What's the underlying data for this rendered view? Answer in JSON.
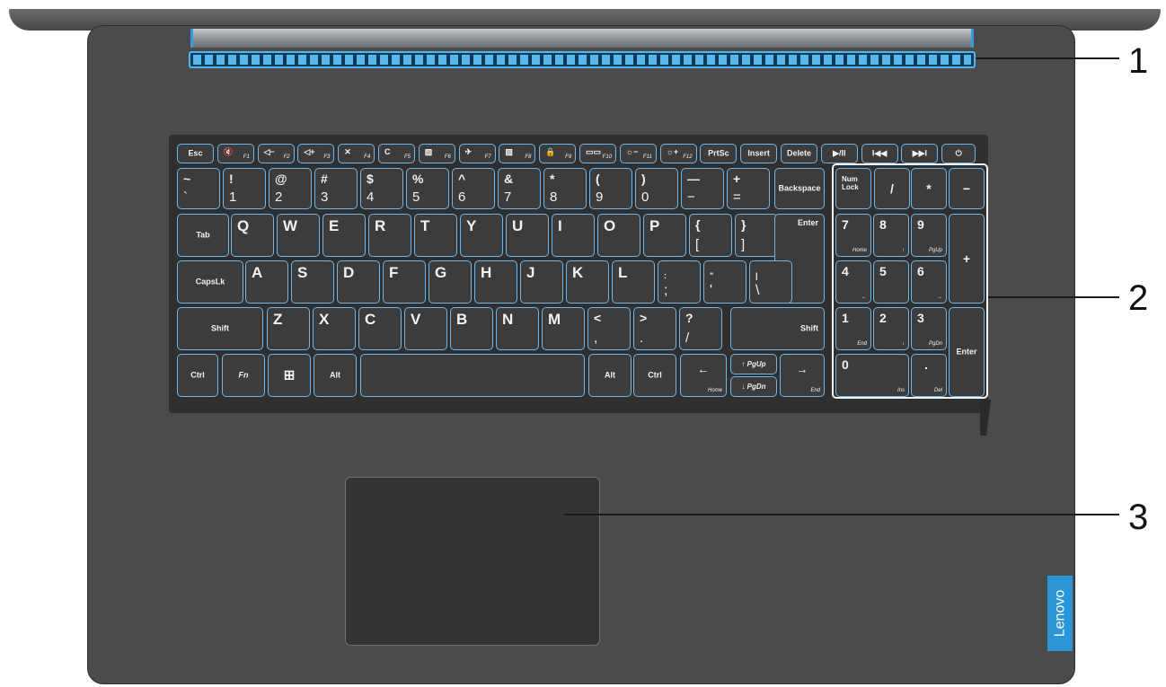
{
  "brand": {
    "logo_text": "Lenovo",
    "logo_color": "#2a96d6"
  },
  "callouts": [
    "1",
    "2",
    "3"
  ],
  "colors": {
    "key_backlight": "#6fb6ea",
    "deck": "#4b4b4b"
  },
  "keyboard": {
    "function_row": [
      {
        "main": "Esc",
        "sub": ""
      },
      {
        "main": "🔇",
        "sub": "F1"
      },
      {
        "main": "◁−",
        "sub": "F2"
      },
      {
        "main": "◁+",
        "sub": "F3"
      },
      {
        "main": "✕",
        "sub": "F4"
      },
      {
        "main": "C",
        "sub": "F5"
      },
      {
        "main": "▧",
        "sub": "F6"
      },
      {
        "main": "✈",
        "sub": "F7"
      },
      {
        "main": "▨",
        "sub": "F8"
      },
      {
        "main": "🔒",
        "sub": "F9"
      },
      {
        "main": "▭▭",
        "sub": "F10"
      },
      {
        "main": "☼−",
        "sub": "F11"
      },
      {
        "main": "☼+",
        "sub": "F12"
      },
      {
        "main": "PrtSc",
        "sub": ""
      },
      {
        "main": "Insert",
        "sub": ""
      },
      {
        "main": "Delete",
        "sub": ""
      },
      {
        "main": "▶/II",
        "sub": ""
      },
      {
        "main": "I◀◀",
        "sub": ""
      },
      {
        "main": "▶▶I",
        "sub": ""
      },
      {
        "main": "⏻",
        "sub": ""
      }
    ],
    "number_row": [
      {
        "top": "~",
        "bottom": "`"
      },
      {
        "top": "!",
        "bottom": "1"
      },
      {
        "top": "@",
        "bottom": "2"
      },
      {
        "top": "#",
        "bottom": "3"
      },
      {
        "top": "$",
        "bottom": "4"
      },
      {
        "top": "%",
        "bottom": "5"
      },
      {
        "top": "^",
        "bottom": "6"
      },
      {
        "top": "&",
        "bottom": "7"
      },
      {
        "top": "*",
        "bottom": "8"
      },
      {
        "top": "(",
        "bottom": "9"
      },
      {
        "top": ")",
        "bottom": "0"
      },
      {
        "top": "—",
        "bottom": "−"
      },
      {
        "top": "+",
        "bottom": "="
      }
    ],
    "backspace": "Backspace",
    "tab": "Tab",
    "qwerty": [
      "Q",
      "W",
      "E",
      "R",
      "T",
      "Y",
      "U",
      "I",
      "O",
      "P"
    ],
    "bracket_keys": [
      {
        "top": "{",
        "bottom": "["
      },
      {
        "top": "}",
        "bottom": "]"
      }
    ],
    "enter": "Enter",
    "capslock": "CapsLk",
    "asdf": [
      "A",
      "S",
      "D",
      "F",
      "G",
      "H",
      "J",
      "K",
      "L"
    ],
    "home_punct": [
      {
        "top": ":",
        "bottom": ";"
      },
      {
        "top": "\"",
        "bottom": "'"
      },
      {
        "top": "|",
        "bottom": "\\"
      }
    ],
    "shift": "Shift",
    "zxcv": [
      "Z",
      "X",
      "C",
      "V",
      "B",
      "N",
      "M"
    ],
    "bottom_punct": [
      {
        "top": "<",
        "bottom": ","
      },
      {
        "top": ">",
        "bottom": "."
      },
      {
        "top": "?",
        "bottom": "/"
      }
    ],
    "bottom_row": {
      "ctrl": "Ctrl",
      "fn": "Fn",
      "win": "⊞",
      "alt": "Alt",
      "left_arrow": "←",
      "home": "Home",
      "up_arrow": "↑",
      "pgup": "PgUp",
      "down_arrow": "↓",
      "pgdn": "PgDn",
      "right_arrow": "→",
      "end": "End"
    },
    "numpad": {
      "numlock_1": "Num",
      "numlock_2": "Lock",
      "slash": "/",
      "star": "*",
      "minus": "−",
      "plus": "+",
      "enter": "Enter",
      "keys": [
        {
          "top": "7",
          "sub": "Home"
        },
        {
          "top": "8",
          "sub": "↑"
        },
        {
          "top": "9",
          "sub": "PgUp"
        },
        {
          "top": "4",
          "sub": "←"
        },
        {
          "top": "5",
          "sub": ""
        },
        {
          "top": "6",
          "sub": "→"
        },
        {
          "top": "1",
          "sub": "End"
        },
        {
          "top": "2",
          "sub": "↓"
        },
        {
          "top": "3",
          "sub": "PgDn"
        }
      ],
      "zero": "0",
      "ins": "Ins",
      "dot": ".",
      "del": "Del"
    }
  }
}
